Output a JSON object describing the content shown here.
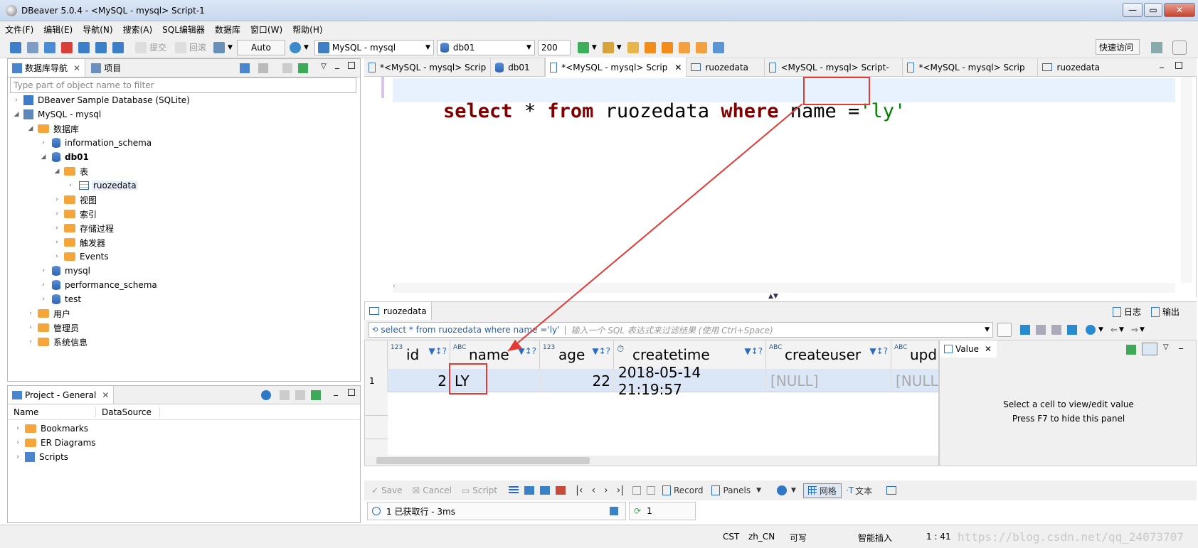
{
  "window": {
    "title": "DBeaver 5.0.4 - <MySQL - mysql> Script-1",
    "min": "—",
    "max": "▭",
    "close": "✕"
  },
  "menu": [
    "文件(F)",
    "编辑(E)",
    "导航(N)",
    "搜索(A)",
    "SQL编辑器",
    "数据库",
    "窗口(W)",
    "帮助(H)"
  ],
  "toolbar": {
    "commit": "提交",
    "rollback": "回滚",
    "mode": "Auto",
    "connection": "MySQL - mysql",
    "database": "db01",
    "limit": "200",
    "quick_access": "快速访问"
  },
  "nav": {
    "tab1": "数据库导航",
    "tab2": "项目",
    "filter_placeholder": "Type part of object name to filter",
    "tree": [
      {
        "label": "DBeaver Sample Database (SQLite)",
        "level": 0
      },
      {
        "label": "MySQL - mysql",
        "level": 0
      },
      {
        "label": "数据库",
        "level": 1
      },
      {
        "label": "information_schema",
        "level": 2
      },
      {
        "label": "db01",
        "level": 2
      },
      {
        "label": "表",
        "level": 3
      },
      {
        "label": "ruozedata",
        "level": 4
      },
      {
        "label": "视图",
        "level": 3
      },
      {
        "label": "索引",
        "level": 3
      },
      {
        "label": "存储过程",
        "level": 3
      },
      {
        "label": "触发器",
        "level": 3
      },
      {
        "label": "Events",
        "level": 3
      },
      {
        "label": "mysql",
        "level": 2
      },
      {
        "label": "performance_schema",
        "level": 2
      },
      {
        "label": "test",
        "level": 2
      },
      {
        "label": "用户",
        "level": 1
      },
      {
        "label": "管理员",
        "level": 1
      },
      {
        "label": "系统信息",
        "level": 1
      }
    ]
  },
  "project": {
    "tab": "Project - General",
    "col_name": "Name",
    "col_ds": "DataSource",
    "items": [
      "Bookmarks",
      "ER Diagrams",
      "Scripts"
    ]
  },
  "editor_tabs": [
    "*<MySQL - mysql> Scrip",
    "db01",
    "*<MySQL - mysql> Scrip",
    "ruozedata",
    "<MySQL - mysql> Script-",
    "*<MySQL - mysql> Scrip",
    "ruozedata"
  ],
  "sql": {
    "kw_select": "select",
    "star": " * ",
    "kw_from": "from",
    "table": " ruozedata ",
    "kw_where": "where",
    "col": " name =",
    "val": "'ly'"
  },
  "results": {
    "tab": "ruozedata",
    "log": "日志",
    "output": "输出",
    "filter_query": "select * from ruozedata where name ='ly'",
    "filter_placeholder": "输入一个 SQL 表达式来过滤结果 (使用 Ctrl+Space)",
    "columns": [
      {
        "type": "123",
        "name": "id"
      },
      {
        "type": "ABC",
        "name": "name"
      },
      {
        "type": "123",
        "name": "age"
      },
      {
        "type": "⏱",
        "name": "createtime"
      },
      {
        "type": "ABC",
        "name": "createuser"
      },
      {
        "type": "ABC",
        "name": "upd"
      }
    ],
    "rows": [
      {
        "num": "1",
        "id": "2",
        "name": "LY",
        "age": "22",
        "createtime": "2018-05-14 21:19:57",
        "createuser": "[NULL]",
        "upd": "[NULL"
      }
    ],
    "value_panel": {
      "title": "Value",
      "line1": "Select a cell to view/edit value",
      "line2": "Press F7 to hide this panel"
    },
    "bottom": {
      "save": "Save",
      "cancel": "Cancel",
      "script": "Script",
      "record": "Record",
      "panels": "Panels",
      "grid": "网格",
      "text": "文本"
    },
    "status": "1 已获取行 - 3ms",
    "count": "1"
  },
  "statusbar": {
    "tz": "CST",
    "locale": "zh_CN",
    "writable": "可写",
    "insert": "智能插入",
    "pos": "1 : 41",
    "watermark": "https://blog.csdn.net/qq_24073707"
  }
}
